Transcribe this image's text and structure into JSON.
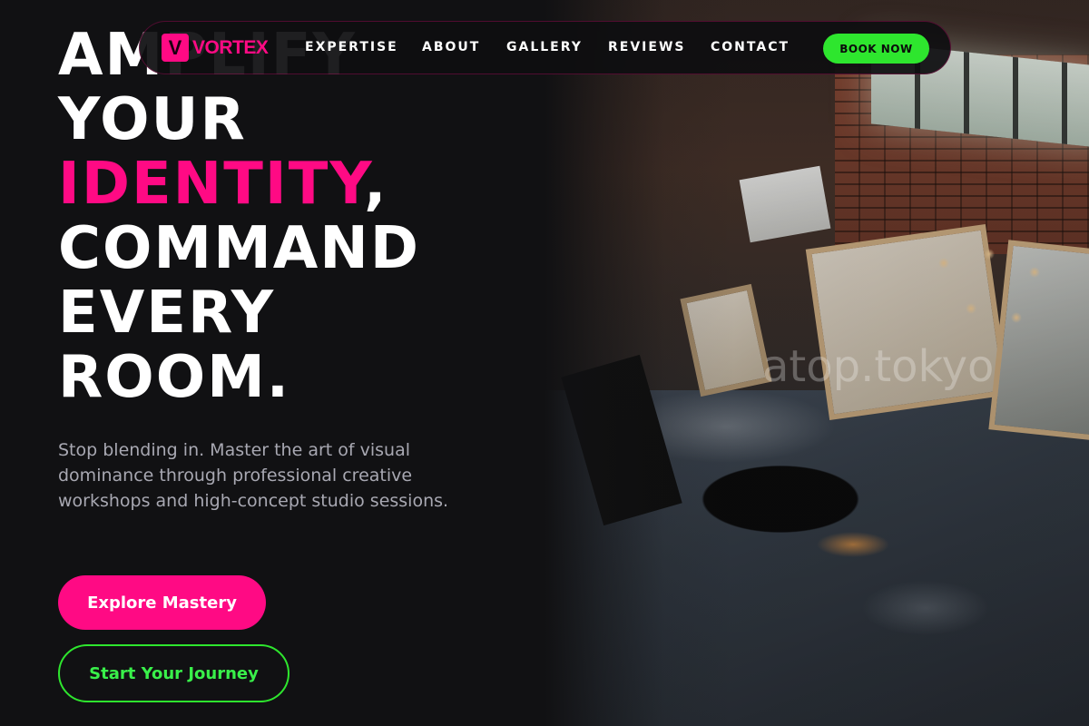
{
  "brand": {
    "mark": "V",
    "name": "VORTEX",
    "accent_color": "#ff0a84",
    "secondary_color": "#2ee62e"
  },
  "nav": {
    "links": [
      "EXPERTISE",
      "ABOUT",
      "GALLERY",
      "REVIEWS",
      "CONTACT"
    ],
    "cta_label": "BOOK NOW"
  },
  "hero": {
    "headline_lines": [
      "AMPLIFY",
      "YOUR",
      "IDENTITY",
      ",",
      "COMMAND",
      "EVERY",
      "ROOM."
    ],
    "subtext": "Stop blending in. Master the art of visual dominance through professional creative workshops and high-concept studio sessions.",
    "primary_button": "Explore Mastery",
    "secondary_button": "Start Your Journey",
    "image_watermark": "atop.tokyo",
    "image_alt": "Art studio with canvases, chandelier and paint-splattered floor"
  }
}
